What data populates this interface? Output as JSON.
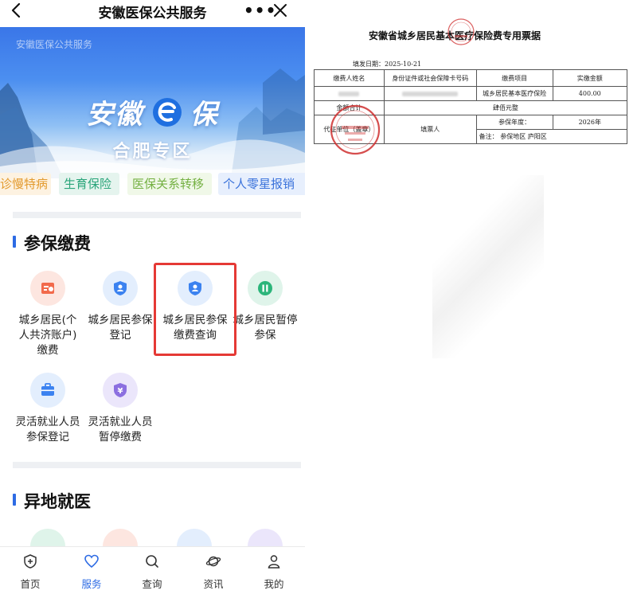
{
  "app": {
    "title": "安徽医保公共服务",
    "more_icon": "more-icon",
    "close_icon": "close-icon",
    "back_icon": "back-icon"
  },
  "banner": {
    "watermark": "安徽医保公共服务",
    "logo_left": "安徽",
    "logo_right": "保",
    "subtitle": "合肥专区"
  },
  "chips": [
    {
      "label": "诊慢特病",
      "color": "#e39a2d"
    },
    {
      "label": "生育保险",
      "color": "#2aa57a"
    },
    {
      "label": "医保关系转移",
      "color": "#74b042"
    },
    {
      "label": "个人零星报销",
      "color": "#3b73db"
    }
  ],
  "sections": {
    "insurance": {
      "title": "参保缴费",
      "items": [
        {
          "label": "城乡居民(个人共济账户) 缴费",
          "icon": "receipt-icon",
          "color": "#f26a4b"
        },
        {
          "label": "城乡居民参保登记",
          "icon": "user-shield-icon",
          "color": "#3b82f0"
        },
        {
          "label": "城乡居民参保缴费查询",
          "icon": "user-shield-icon",
          "color": "#3b82f0"
        },
        {
          "label": "城乡居民暂停参保",
          "icon": "pause-icon",
          "color": "#2bb57a"
        },
        {
          "label": "灵活就业人员参保登记",
          "icon": "briefcase-icon",
          "color": "#3b82f0"
        },
        {
          "label": "灵活就业人员暂停缴费",
          "icon": "yen-shield-icon",
          "color": "#8b6fe0"
        }
      ]
    },
    "remote": {
      "title": "异地就医"
    }
  },
  "tabbar": [
    {
      "label": "首页",
      "icon": "home-shield-icon",
      "active": false
    },
    {
      "label": "服务",
      "icon": "heart-icon",
      "active": true
    },
    {
      "label": "查询",
      "icon": "search-icon",
      "active": false
    },
    {
      "label": "资讯",
      "icon": "planet-icon",
      "active": false
    },
    {
      "label": "我的",
      "icon": "person-icon",
      "active": false
    }
  ],
  "receipt": {
    "title": "安徽省城乡居民基本医疗保险费专用票据",
    "issue_date": "填发日期：2025-10-21",
    "headers": [
      "缴费人姓名",
      "身份证件或社会保障卡号码",
      "缴费项目",
      "实缴金额"
    ],
    "item": "城乡居民基本医疗保险",
    "amount": "400.00",
    "total_label": "金额合计",
    "total_value": "肆佰元整",
    "agent_label": "代征单位（盖章）",
    "filler_label": "填票人",
    "year_label": "参保年度：",
    "year_value": "2026年",
    "note": "备注：  参保地区  庐阳区"
  }
}
